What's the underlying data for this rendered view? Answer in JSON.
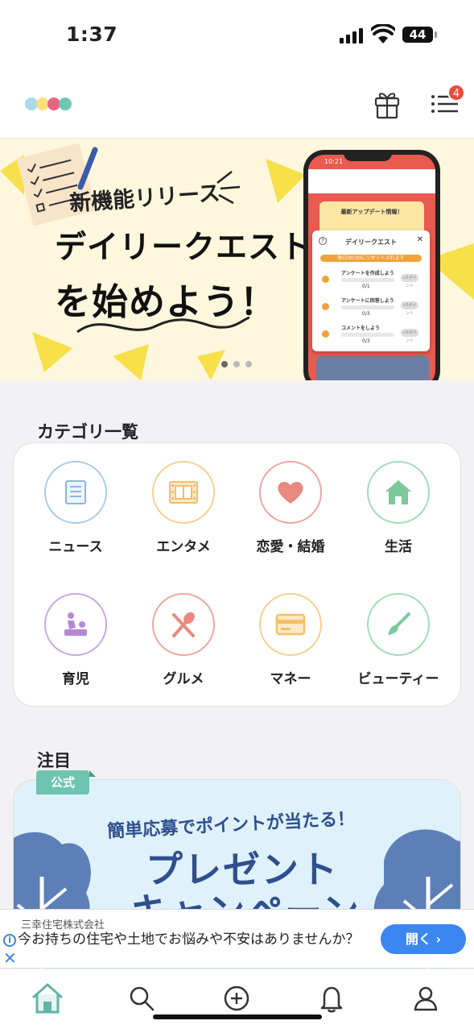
{
  "status_bar": {
    "time": "1:37",
    "battery": "44"
  },
  "header": {
    "logo_colors": [
      "#a9d8ef",
      "#f6e17a",
      "#e6667f",
      "#6fc7b6"
    ],
    "notification_count": "4"
  },
  "banner": {
    "tag": "新機能リリース",
    "headline_line1": "デイリークエスト",
    "headline_line2": "を始めよう！",
    "page_indicator": {
      "count": 3,
      "active": 0
    },
    "phone_mock": {
      "time": "10:21",
      "update_title": "最新アップデート情報！",
      "quest_title": "デイリークエスト",
      "reset_note": "毎日00:00にリセットされます",
      "quests": [
        {
          "name": "アンケートを作成しよう",
          "progress": "0/1",
          "button": "+5ポイント"
        },
        {
          "name": "アンケートに回答しよう",
          "progress": "0/3",
          "button": "+5ポイント"
        },
        {
          "name": "コメントをしよう",
          "progress": "0/3",
          "button": "+5ポイント"
        }
      ]
    }
  },
  "categories": {
    "title": "カテゴリ一覧",
    "items": [
      {
        "label": "ニュース",
        "icon": "newspaper-icon",
        "color": "#7fb5e0"
      },
      {
        "label": "エンタメ",
        "icon": "film-icon",
        "color": "#f0c06a"
      },
      {
        "label": "恋愛・結婚",
        "icon": "heart-icon",
        "color": "#e88a80"
      },
      {
        "label": "生活",
        "icon": "home-icon",
        "color": "#7cc99a"
      },
      {
        "label": "育児",
        "icon": "baby-care-icon",
        "color": "#b48ad6"
      },
      {
        "label": "グルメ",
        "icon": "fork-spoon-icon",
        "color": "#e88a80"
      },
      {
        "label": "マネー",
        "icon": "card-icon",
        "color": "#f0c06a"
      },
      {
        "label": "ビューティー",
        "icon": "brush-icon",
        "color": "#7cc99a"
      }
    ]
  },
  "featured": {
    "title": "注目",
    "badge": "公式",
    "sub": "簡単応募でポイントが当たる！",
    "big_line1": "プレゼント",
    "big_line2": "キャンペーン"
  },
  "ad": {
    "advertiser": "三幸住宅株式会社",
    "copy": "今お持ちの住宅や土地でお悩みや不安はありませんか？",
    "cta": "開く ›"
  },
  "tabbar": {
    "tabs": [
      "home-icon",
      "search-icon",
      "add-icon",
      "bell-icon",
      "profile-icon"
    ],
    "active": "home-icon"
  }
}
